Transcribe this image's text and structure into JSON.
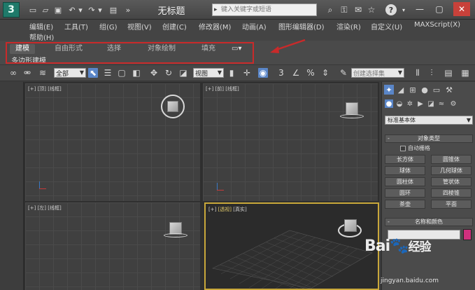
{
  "titlebar": {
    "title": "无标题",
    "search_placeholder": "键入关键字或短语",
    "help_glyph": "?",
    "app_logo_icon": "3dsmax-logo-icon",
    "quick_access_icons": [
      "new-file-icon",
      "open-folder-icon",
      "save-icon",
      "undo-icon",
      "redo-icon",
      "project-folder-icon",
      "more-icon"
    ],
    "right_icons": [
      "binoculars-icon",
      "key-icon",
      "favorites-icon",
      "star-icon"
    ],
    "window_controls": [
      "minimize",
      "maximize",
      "close"
    ]
  },
  "menu": {
    "items": [
      "编辑(E)",
      "工具(T)",
      "组(G)",
      "视图(V)",
      "创建(C)",
      "修改器(M)",
      "动画(A)",
      "图形编辑器(D)",
      "渲染(R)",
      "自定义(U)",
      "MAXScript(X)",
      "帮助(H)"
    ]
  },
  "ribbon": {
    "tabs": [
      "建模",
      "自由形式",
      "选择",
      "对象绘制",
      "填充"
    ],
    "active_tab": "建模",
    "sub_label": "多边形建模",
    "highlight_color": "#c92a2a"
  },
  "toolbar": {
    "filter_value": "全部",
    "refcoord_value": "视图",
    "named_sel_value": "创建选择集"
  },
  "viewports": {
    "top_left": "[+] [顶] [线框]",
    "top_right": "[+] [前] [线框]",
    "bottom_left": "[+] [左] [线框]",
    "bottom_right_bracket": "[+]",
    "bottom_right_view": "[透视]",
    "bottom_right_shading": "[真实]",
    "active_border_color": "#c9a83a"
  },
  "command_panel": {
    "category_value": "标准基本体",
    "object_type_title": "对象类型",
    "autogrid_label": "自动栅格",
    "primitives": [
      "长方体",
      "圆锥体",
      "球体",
      "几何球体",
      "圆柱体",
      "管状体",
      "圆环",
      "四棱锥",
      "茶壶",
      "平面"
    ],
    "name_color_title": "名称和颜色",
    "object_color": "#d1307e"
  },
  "watermark": {
    "logo_text": "Bai",
    "logo_suffix": "经验",
    "url": "jingyan.baidu.com"
  }
}
